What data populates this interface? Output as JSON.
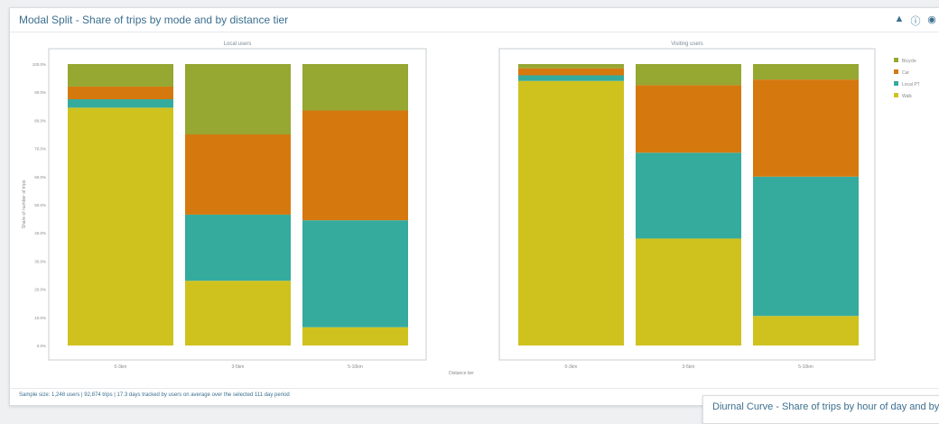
{
  "panel": {
    "title": "Modal Split - Share of trips by mode and by distance tier",
    "icons": [
      "triangle-up-icon",
      "info-icon",
      "eye-icon"
    ],
    "footer": "Sample size: 1,248 users | 92,874 trips | 17.3 days tracked by users on average over the selected 111 day period"
  },
  "panel2": {
    "title": "Diurnal Curve - Share of trips by hour of day and by"
  },
  "chart_data": {
    "type": "bar",
    "stacked": true,
    "categories": [
      "0-3km",
      "3-5km",
      "5-10km"
    ],
    "xlabel": "Distance tier",
    "ylabel": "Share of number of trips",
    "ylim": [
      0,
      100
    ],
    "yticks": [
      "0.0%",
      "10.0%",
      "20.0%",
      "30.0%",
      "40.0%",
      "50.0%",
      "60.0%",
      "70.0%",
      "80.0%",
      "90.0%",
      "100.0%"
    ],
    "grid": false,
    "legend": "right",
    "series_names": [
      "Walk",
      "Local PT",
      "Car",
      "Bicycle"
    ],
    "colors": {
      "Walk": "#cfc21f",
      "Local PT": "#35ab9e",
      "Car": "#d5790f",
      "Bicycle": "#96a732"
    },
    "legend_order": [
      "Bicycle",
      "Car",
      "Local PT",
      "Walk"
    ],
    "facets": [
      {
        "title": "Local users",
        "series": [
          {
            "name": "Walk",
            "values": [
              84.5,
              23,
              6.5
            ]
          },
          {
            "name": "Local PT",
            "values": [
              3,
              23.5,
              38
            ]
          },
          {
            "name": "Car",
            "values": [
              4.5,
              28.5,
              39
            ]
          },
          {
            "name": "Bicycle",
            "values": [
              8,
              25,
              16.5
            ]
          }
        ]
      },
      {
        "title": "Visiting users",
        "series": [
          {
            "name": "Walk",
            "values": [
              94,
              38,
              10.5
            ]
          },
          {
            "name": "Local PT",
            "values": [
              2,
              30.5,
              49.5
            ]
          },
          {
            "name": "Car",
            "values": [
              2.5,
              24,
              34.5
            ]
          },
          {
            "name": "Bicycle",
            "values": [
              1.5,
              7.5,
              5.5
            ]
          }
        ]
      }
    ]
  }
}
